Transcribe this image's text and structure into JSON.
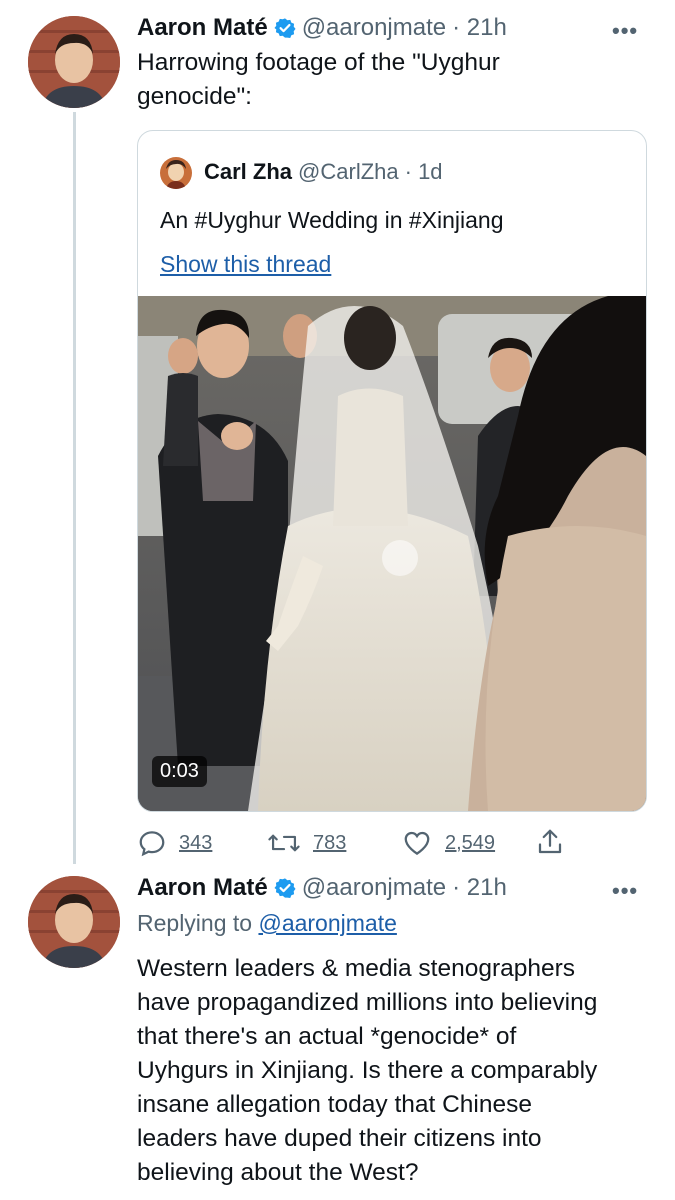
{
  "tweet1": {
    "name": "Aaron Maté",
    "handle": "@aaronjmate",
    "time": "· 21h",
    "more": "•••",
    "text_line1": "Harrowing footage of the \"Uyghur",
    "text_line2": "genocide\":",
    "avatar_icon": "profile-photo"
  },
  "quote": {
    "name": "Carl Zha",
    "handle": "@CarlZha",
    "time": "· 1d",
    "text": "An #Uyghur Wedding in #Xinjiang",
    "show_thread": "Show this thread",
    "video_duration": "0:03"
  },
  "actions": {
    "replies": "343",
    "retweets": "783",
    "likes": "2,549",
    "reply_icon": "reply-icon",
    "retweet_icon": "retweet-icon",
    "like_icon": "heart-icon",
    "share_icon": "share-icon"
  },
  "tweet2": {
    "name": "Aaron Maté",
    "handle": "@aaronjmate",
    "time": "· 21h",
    "more": "•••",
    "replying_prefix": "Replying to",
    "replying_to": "@aaronjmate",
    "lines": [
      "Western leaders & media stenographers",
      "have  propagandized millions into believing",
      "that there's an actual *genocide* of",
      "Uyhgurs in Xinjiang. Is there a comparably",
      "insane allegation today that Chinese",
      "leaders have duped their citizens into",
      "believing about the West?"
    ]
  },
  "colors": {
    "verified": "#1d9bf0",
    "link": "#1d5ea8",
    "muted": "#536471",
    "border": "#cfd9de"
  }
}
